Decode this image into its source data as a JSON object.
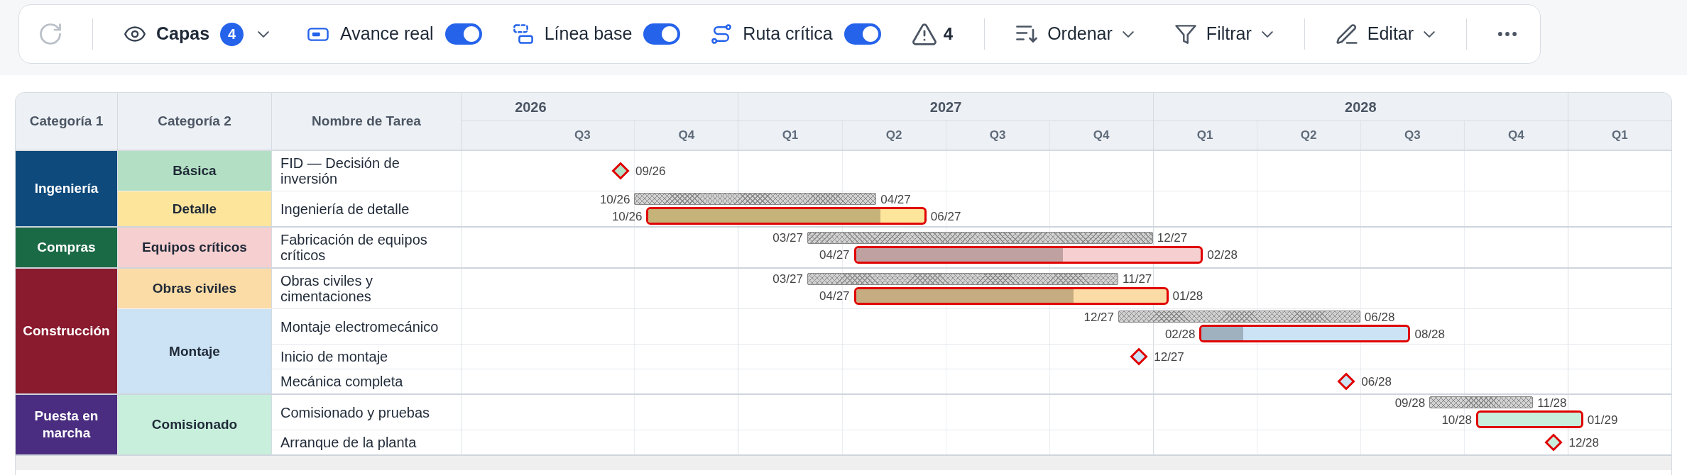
{
  "toolbar": {
    "refresh": {
      "disabled": true
    },
    "layers": {
      "label": "Capas",
      "badge": "4"
    },
    "toggles": [
      {
        "kind": "progress",
        "label": "Avance real",
        "on": true
      },
      {
        "kind": "baseline",
        "label": "Línea base",
        "on": true
      },
      {
        "kind": "critical_path",
        "label": "Ruta crítica",
        "on": true
      }
    ],
    "warnings": {
      "count": "4"
    },
    "menus": [
      {
        "kind": "sort",
        "label": "Ordenar"
      },
      {
        "kind": "filter",
        "label": "Filtrar"
      },
      {
        "kind": "edit",
        "label": "Editar"
      }
    ]
  },
  "table": {
    "columns": [
      "Categoría 1",
      "Categoría 2",
      "Nombre de Tarea"
    ],
    "timeline": {
      "years": [
        {
          "label": "2026",
          "quarters": [
            "Q3",
            "Q4"
          ]
        },
        {
          "label": "2027",
          "quarters": [
            "Q1",
            "Q2",
            "Q3",
            "Q4"
          ]
        },
        {
          "label": "2028",
          "quarters": [
            "Q1",
            "Q2",
            "Q3",
            "Q4"
          ]
        },
        {
          "quarters": [
            "Q1"
          ]
        }
      ]
    },
    "groups": [
      {
        "label": "Ingeniería",
        "color": "#0e4a7c",
        "subgroups": [
          {
            "label": "Básica",
            "color": "#b3e0c4",
            "tasks": [
              {
                "kind": "milestone",
                "name": "FID — Decisión de inversión",
                "date": "09/26",
                "critical": true
              }
            ]
          },
          {
            "label": "Detalle",
            "color": "#fde59c",
            "tasks": [
              {
                "kind": "bar",
                "name": "Ingeniería de detalle",
                "baseline": {
                  "start": "10/26",
                  "end": "04/27"
                },
                "actual": {
                  "start": "10/26",
                  "end": "06/27",
                  "level": 0.84
                },
                "critical": true
              }
            ]
          }
        ]
      },
      {
        "label": "Compras",
        "color": "#1b6a46",
        "subgroups": [
          {
            "label": "Equipos críticos",
            "color": "#f6cfd0",
            "tasks": [
              {
                "kind": "bar",
                "name": "Fabricación de equipos críticos",
                "baseline": {
                  "start": "03/27",
                  "end": "12/27"
                },
                "actual": {
                  "start": "04/27",
                  "end": "02/28",
                  "level": 0.6
                },
                "critical": true
              }
            ]
          }
        ]
      },
      {
        "label": "Construcción",
        "color": "#8a1a2e",
        "subgroups": [
          {
            "label": "Obras civiles",
            "color": "#fcdca6",
            "tasks": [
              {
                "kind": "bar",
                "name": "Obras civiles y cimentaciones",
                "baseline": {
                  "start": "03/27",
                  "end": "11/27"
                },
                "actual": {
                  "start": "04/27",
                  "end": "01/28",
                  "level": 0.7
                },
                "critical": true
              }
            ]
          },
          {
            "label": "Montaje",
            "color": "#cce3f5",
            "tasks": [
              {
                "kind": "bar",
                "name": "Montaje electromecánico",
                "baseline": {
                  "start": "12/27",
                  "end": "06/28"
                },
                "actual": {
                  "start": "02/28",
                  "end": "08/28",
                  "level": 0.2
                },
                "critical": true
              },
              {
                "kind": "milestone",
                "name": "Inicio de montaje",
                "date": "12/27",
                "critical": true
              },
              {
                "kind": "milestone",
                "name": "Mecánica completa",
                "date": "06/28",
                "critical": true
              }
            ]
          }
        ]
      },
      {
        "label": "Puesta en marcha",
        "color": "#4a2d80",
        "subgroups": [
          {
            "label": "Comisionado",
            "color": "#c8efdc",
            "tasks": [
              {
                "kind": "bar",
                "name": "Comisionado y pruebas",
                "baseline": {
                  "start": "09/28",
                  "end": "11/28"
                },
                "actual": {
                  "start": "10/28",
                  "end": "01/29"
                },
                "critical": true
              },
              {
                "kind": "milestone",
                "name": "Arranque de la planta",
                "date": "12/28",
                "critical": true
              }
            ]
          }
        ]
      }
    ]
  }
}
